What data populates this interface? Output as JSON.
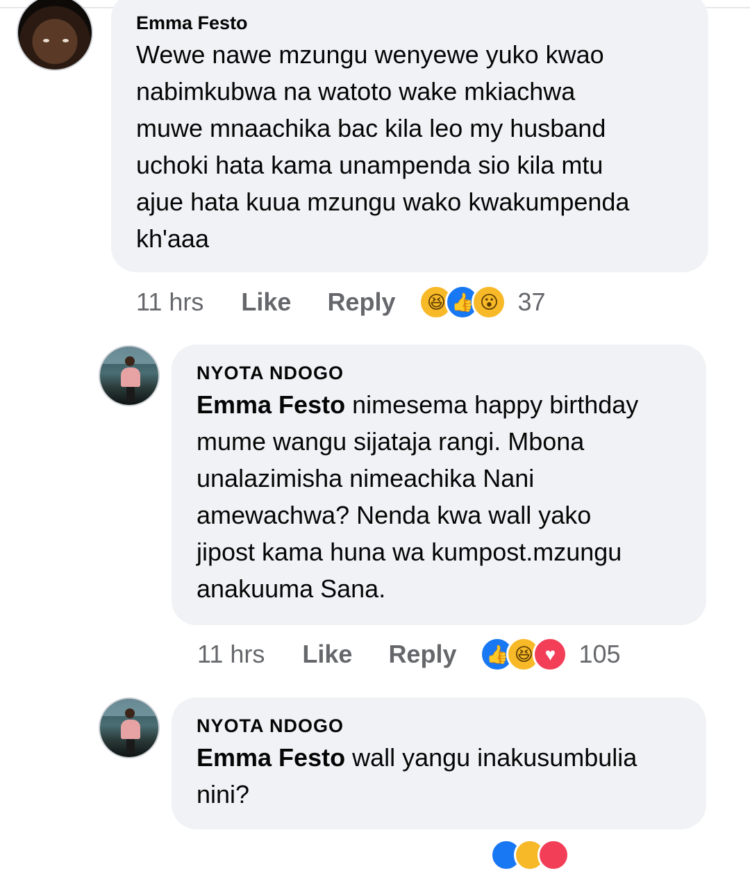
{
  "comments": [
    {
      "author": "Emma Festo",
      "mention": "",
      "lines": [
        "Wewe nawe mzungu wenyewe yuko kwao",
        "nabimkubwa na watoto wake mkiachwa",
        "muwe mnaachika bac kila leo my husband",
        "uchoki hata kama unampenda sio kila mtu",
        "ajue hata kuua mzungu wako kwakumpenda",
        "kh'aaa"
      ],
      "time": "11 hrs",
      "like_label": "Like",
      "reply_label": "Reply",
      "reactions": [
        "haha",
        "like",
        "wow"
      ],
      "reaction_count": "37"
    },
    {
      "author": "NYOTA  NDOGO",
      "mention": "Emma Festo",
      "lines": [
        " nimesema happy birthday",
        "mume wangu sijataja rangi. Mbona",
        "unalazimisha nimeachika Nani",
        "amewachwa? Nenda kwa wall yako",
        "jipost kama huna wa kumpost.mzungu",
        "anakuuma Sana."
      ],
      "time": "11 hrs",
      "like_label": "Like",
      "reply_label": "Reply",
      "reactions": [
        "like",
        "haha",
        "love"
      ],
      "reaction_count": "105"
    },
    {
      "author": "NYOTA  NDOGO",
      "mention": "Emma Festo",
      "lines": [
        " wall yangu inakusumbulia",
        "nini?"
      ]
    }
  ],
  "icons": {
    "like": "👍",
    "haha": "😆",
    "wow": "😮",
    "love": "♥"
  },
  "colors": {
    "bubble": "#f0f2f5",
    "meta_text": "#65676b",
    "like_blue": "#1877f2",
    "haha_yellow": "#f7b928",
    "love_red": "#f33e58"
  }
}
